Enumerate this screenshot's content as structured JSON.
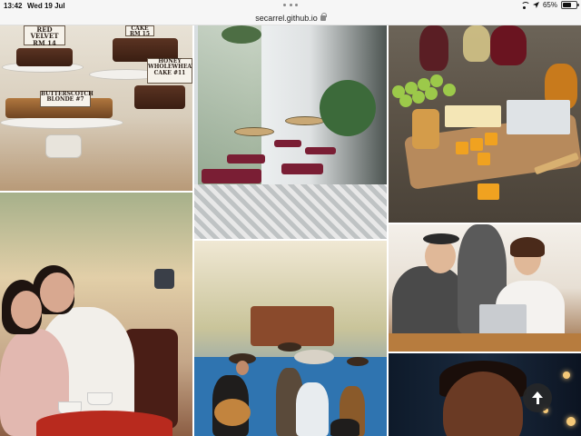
{
  "status_bar": {
    "time": "13:42",
    "date": "Wed 19 Jul",
    "battery": "65%",
    "battery_level": 0.65
  },
  "url_bar": {
    "url": "secarrel.github.io"
  },
  "bakery_signs": {
    "red_velvet": "RED VELVET\nRM 14",
    "cake_top": "CAKE\nRM 15",
    "honey_wholewheat": "HONEY\nWHOLEWHEAT\nCAKE #11",
    "butterscotch": "BUTTERSCOTCH\nBLONDE #7"
  },
  "colors": {
    "statusbar_bg": "#f6f6f6",
    "accent_burgundy": "#7a1e34",
    "cheese_orange": "#f0a220"
  },
  "icons": {
    "wifi": "wifi-icon",
    "location": "location-arrow-icon",
    "battery": "battery-icon",
    "lock": "lock-icon",
    "scroll_top": "arrow-up-icon"
  }
}
